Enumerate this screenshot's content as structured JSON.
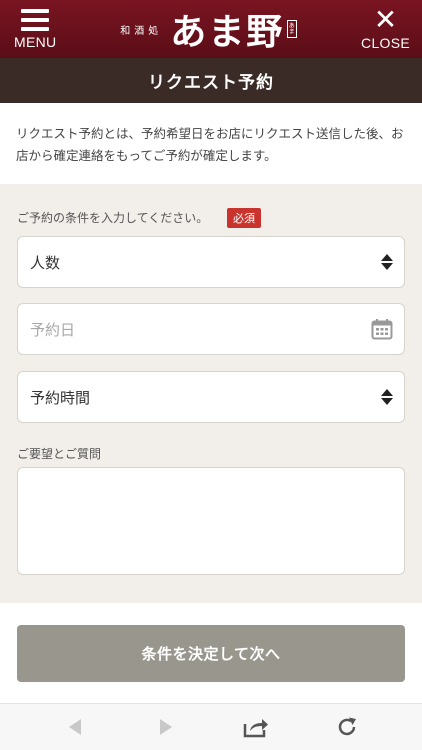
{
  "header": {
    "menu_label": "MENU",
    "close_label": "CLOSE",
    "logo_sub": "和酒処",
    "logo_main": "あま野",
    "logo_stamp": "あまの"
  },
  "page": {
    "title": "リクエスト予約",
    "intro": "リクエスト予約とは、予約希望日をお店にリクエスト送信した後、お店から確定連絡をもってご予約が確定します。"
  },
  "form": {
    "conditions_label": "ご予約の条件を入力してください。",
    "required_badge": "必須",
    "guests_value": "人数",
    "date_placeholder": "予約日",
    "time_value": "予約時間",
    "requests_label": "ご要望とご質問",
    "requests_value": "",
    "submit_label": "条件を決定して次へ"
  },
  "colors": {
    "header": "#6a1020",
    "titlebar": "#3b2b27",
    "badge": "#c8342d",
    "submit": "#99968e"
  }
}
